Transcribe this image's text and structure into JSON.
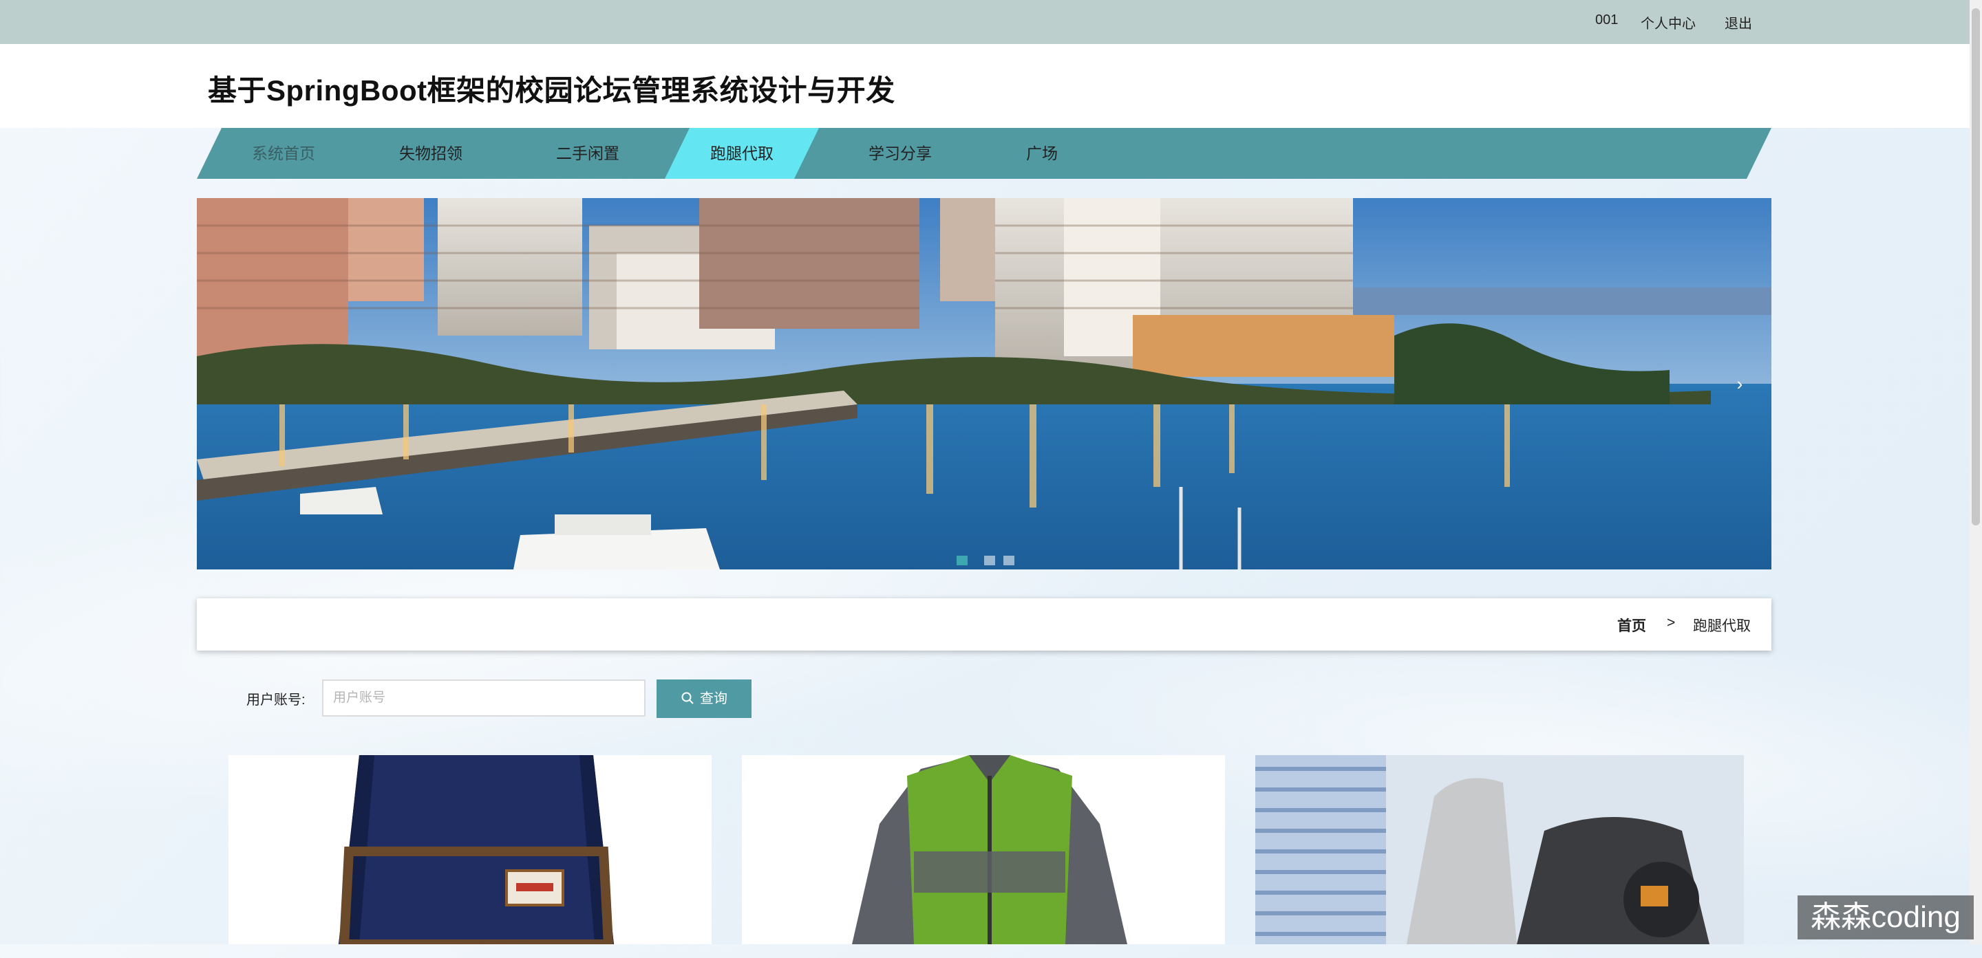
{
  "topbar": {
    "username": "001",
    "profile_link": "个人中心",
    "logout_link": "退出"
  },
  "site": {
    "title": "基于SpringBoot框架的校园论坛管理系统设计与开发"
  },
  "nav": {
    "items": [
      {
        "label": "系统首页",
        "active": false
      },
      {
        "label": "失物招领",
        "active": false
      },
      {
        "label": "二手闲置",
        "active": false
      },
      {
        "label": "跑腿代取",
        "active": true
      },
      {
        "label": "学习分享",
        "active": false
      },
      {
        "label": "广场",
        "active": false
      }
    ]
  },
  "banner": {
    "next_icon": "chevron-right-icon",
    "next_glyph": "›",
    "slides_count": 3,
    "current_slide": 1
  },
  "breadcrumb": {
    "home": "首页",
    "separator": ">",
    "current": "跑腿代取"
  },
  "search": {
    "label": "用户账号:",
    "placeholder": "用户账号",
    "value": "",
    "button_label": "查询",
    "button_icon": "search-icon"
  },
  "cards": [
    {
      "image": "backpack"
    },
    {
      "image": "jacket"
    },
    {
      "image": "scooter"
    }
  ],
  "watermark": {
    "text": "森森coding"
  },
  "colors": {
    "topbar": "#bccfcc",
    "nav": "#519aa2",
    "nav_active": "#63e6f1",
    "button": "#4f9aa3"
  }
}
